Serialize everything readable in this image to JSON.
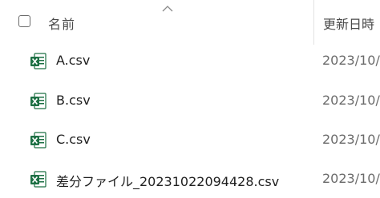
{
  "header": {
    "name_label": "名前",
    "modified_label": "更新日時"
  },
  "files": [
    {
      "name": "A.csv",
      "modified": "2023/10/"
    },
    {
      "name": "B.csv",
      "modified": "2023/10/"
    },
    {
      "name": "C.csv",
      "modified": "2023/10/"
    },
    {
      "name": "差分ファイル_20231022094428.csv",
      "modified": "2023/10/"
    }
  ],
  "icons": {
    "sort": "chevron-up-icon",
    "file": "excel-csv-file-icon"
  },
  "colors": {
    "excel_green": "#1d7044",
    "text": "#1f1f1f",
    "muted_text": "#6b6b6b"
  }
}
